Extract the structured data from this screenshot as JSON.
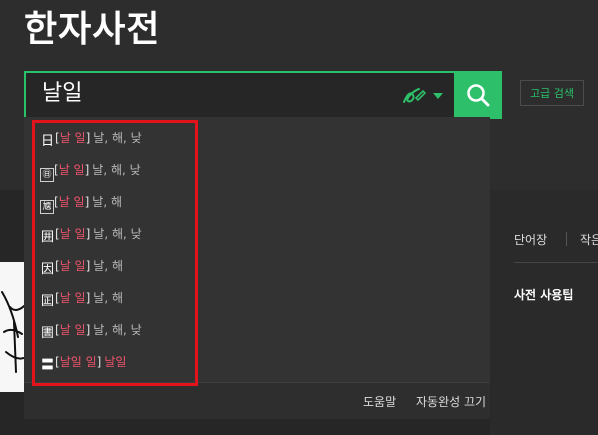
{
  "header": {
    "title": "한자사전"
  },
  "search": {
    "value": "날일"
  },
  "advanced_search_label": "고급 검색",
  "autocomplete": {
    "items": [
      {
        "char": "日",
        "reading": "날 일",
        "meaning": "날, 해, 낮"
      },
      {
        "char": "㊐",
        "reading": "날 일",
        "meaning": "날, 해, 낮"
      },
      {
        "char": "㐡",
        "reading": "날 일",
        "meaning": "날, 해"
      },
      {
        "char": "囲",
        "reading": "날 일",
        "meaning": "날, 해, 낮"
      },
      {
        "char": "因",
        "reading": "날 일",
        "meaning": "날, 해"
      },
      {
        "char": "囸",
        "reading": "날 일",
        "meaning": "날, 해"
      },
      {
        "char": "圕",
        "reading": "날 일",
        "meaning": "날, 해, 낮"
      },
      {
        "char": "〓",
        "reading": "날일 일",
        "meaning": "날일"
      }
    ],
    "help_label": "도움말",
    "off_label": "자동완성 끄기"
  },
  "right_panel": {
    "tab1": "단어장",
    "tab2": "작은",
    "tip": "사전 사용팁"
  },
  "colors": {
    "accent": "#29c26a",
    "reading": "#f0546c",
    "highlight": "#e3131b"
  },
  "icons": [
    "handwriting-icon",
    "dropdown-arrow-icon",
    "search-icon"
  ]
}
